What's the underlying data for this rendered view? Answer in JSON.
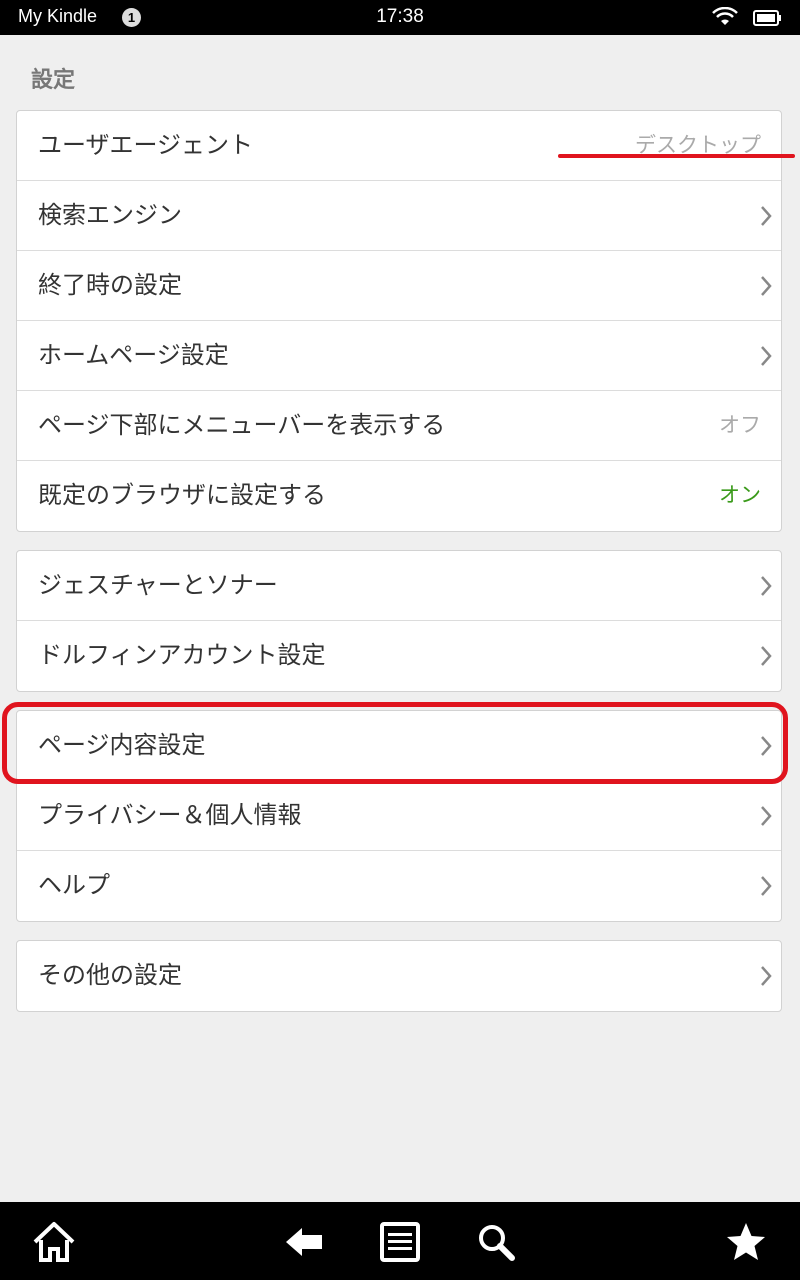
{
  "status_bar": {
    "app_title": "My Kindle",
    "notification_count": "1",
    "time": "17:38",
    "icons": [
      "wifi-icon",
      "battery-icon"
    ]
  },
  "settings": {
    "section_title": "設定",
    "groups": [
      {
        "rows": [
          {
            "label": "ユーザエージェント",
            "value": "デスクトップ"
          },
          {
            "label": "検索エンジン"
          },
          {
            "label": "終了時の設定"
          },
          {
            "label": "ホームページ設定"
          },
          {
            "label": "ページ下部にメニューバーを表示する",
            "value": "オフ"
          },
          {
            "label": "既定のブラウザに設定する",
            "value": "オン"
          }
        ]
      },
      {
        "rows": [
          {
            "label": "ジェスチャーとソナー"
          },
          {
            "label": "ドルフィンアカウント設定"
          }
        ]
      },
      {
        "rows": [
          {
            "label": "ページ内容設定"
          },
          {
            "label": "プライバシー＆個人情報"
          },
          {
            "label": "ヘルプ"
          }
        ]
      },
      {
        "rows": [
          {
            "label": "その他の設定"
          }
        ]
      }
    ]
  },
  "bottom_nav": {
    "items": [
      "home-icon",
      "back-icon",
      "menu-icon",
      "search-icon",
      "star-icon"
    ]
  },
  "colors": {
    "annotation_red": "#e0141e",
    "value_on_green": "#3a9a1a",
    "value_off_gray": "#aaaaaa"
  }
}
